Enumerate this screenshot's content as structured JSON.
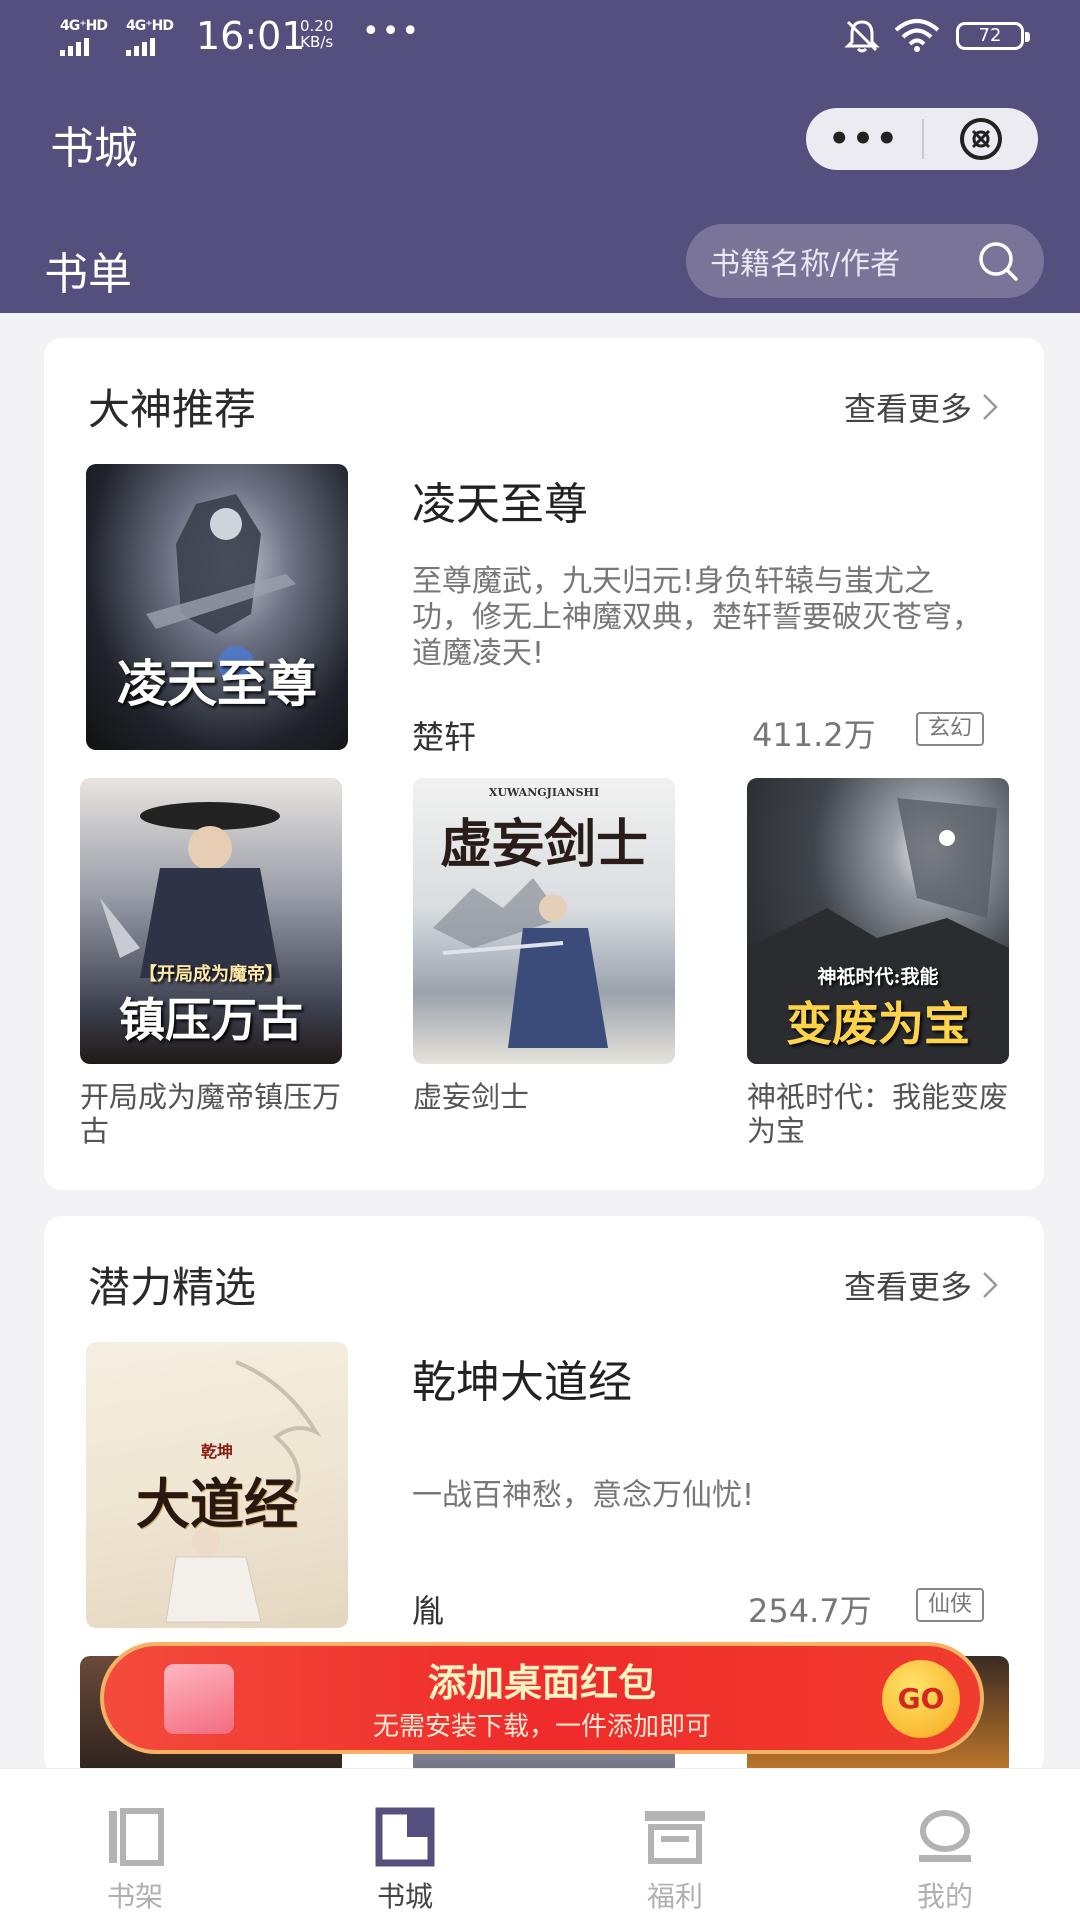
{
  "status_bar": {
    "signal1": "4G⁺HD",
    "signal2": "4G⁺HD",
    "time": "16:01",
    "speed_value": "0.20",
    "speed_unit": "KB/s",
    "battery": "72"
  },
  "nav": {
    "title": "书城",
    "more_glyph": "•••"
  },
  "section": {
    "title": "书单",
    "search_placeholder": "书籍名称/作者"
  },
  "cards": [
    {
      "title": "大神推荐",
      "more": "查看更多",
      "featured": {
        "title": "凌天至尊",
        "cover_text": "凌天至尊",
        "description": "至尊魔武，九天归元!身负轩辕与蚩尤之功，修无上神魔双典，楚轩誓要破灭苍穹，道魔凌天!",
        "author": "楚轩",
        "count": "411.2万",
        "tag": "玄幻"
      },
      "books": [
        {
          "name": "开局成为魔帝镇压万古",
          "cover_top": "【开局成为魔帝】",
          "cover_text": "镇压万古"
        },
        {
          "name": "虚妄剑士",
          "cover_top": "XUWANGJIANSHI",
          "cover_text": "虚妄剑士"
        },
        {
          "name": "神祇时代：我能变废为宝",
          "cover_top": "神祇时代:我能",
          "cover_text": "变废为宝"
        }
      ]
    },
    {
      "title": "潜力精选",
      "more": "查看更多",
      "featured": {
        "title": "乾坤大道经",
        "cover_top": "乾坤",
        "cover_text": "大道经",
        "description": "一战百神愁，意念万仙忧!",
        "author": "胤",
        "count": "254.7万",
        "tag": "仙侠"
      }
    }
  ],
  "promo": {
    "title": "添加桌面红包",
    "subtitle": "无需安装下载，一件添加即可",
    "go": "GO"
  },
  "tabs": [
    {
      "label": "书架",
      "icon": "bookshelf-icon"
    },
    {
      "label": "书城",
      "icon": "bookstore-icon"
    },
    {
      "label": "福利",
      "icon": "welfare-icon"
    },
    {
      "label": "我的",
      "icon": "profile-icon"
    }
  ],
  "colors": {
    "header": "#554f7e",
    "active_tab": "#554f7e",
    "promo_red": "#ef2b2b"
  }
}
